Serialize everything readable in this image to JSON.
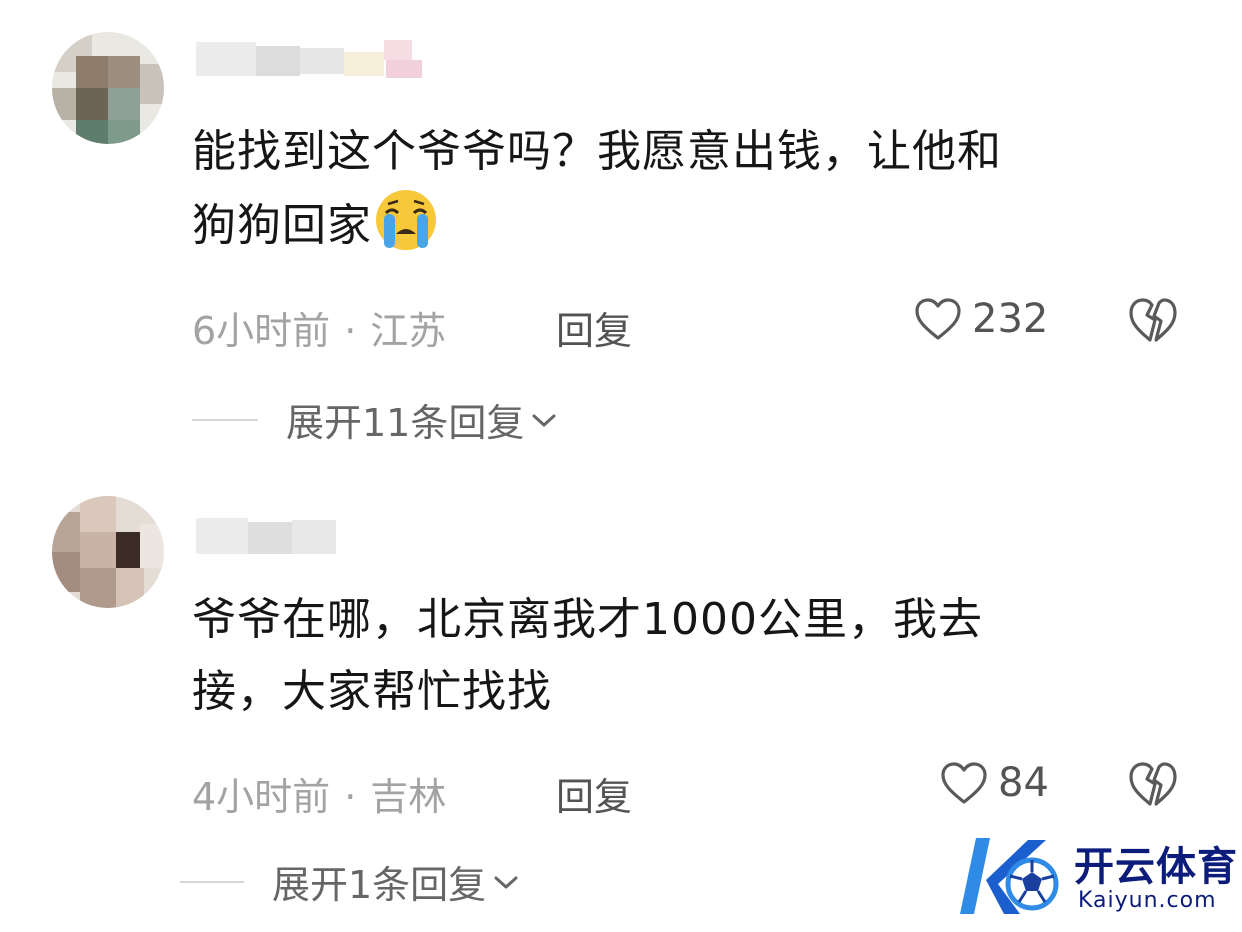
{
  "comments": [
    {
      "text_line1": "能找到这个爷爷吗？我愿意出钱，让他和",
      "text_line2": "狗狗回家",
      "emoji": "loudly-crying-face",
      "time": "6小时前",
      "location": "江苏",
      "reply_label": "回复",
      "likes": "232",
      "expand_label": "展开11条回复"
    },
    {
      "text_line1": "爷爷在哪，北京离我才1000公里，我去",
      "text_line2": "接，大家帮忙找找",
      "time": "4小时前",
      "location": "吉林",
      "reply_label": "回复",
      "likes": "84",
      "expand_label": "展开1条回复"
    }
  ],
  "separator": "·",
  "icons": {
    "like": "heart-outline-icon",
    "dislike": "broken-heart-icon",
    "expand": "chevron-down-icon"
  },
  "watermark": {
    "brand_cn": "开云体育",
    "brand_en": "Kaiyun.com"
  },
  "colors": {
    "text": "#161616",
    "meta": "#a3a3a3",
    "brand": "#0b1c7a",
    "brand_accent": "#2f8be6"
  }
}
